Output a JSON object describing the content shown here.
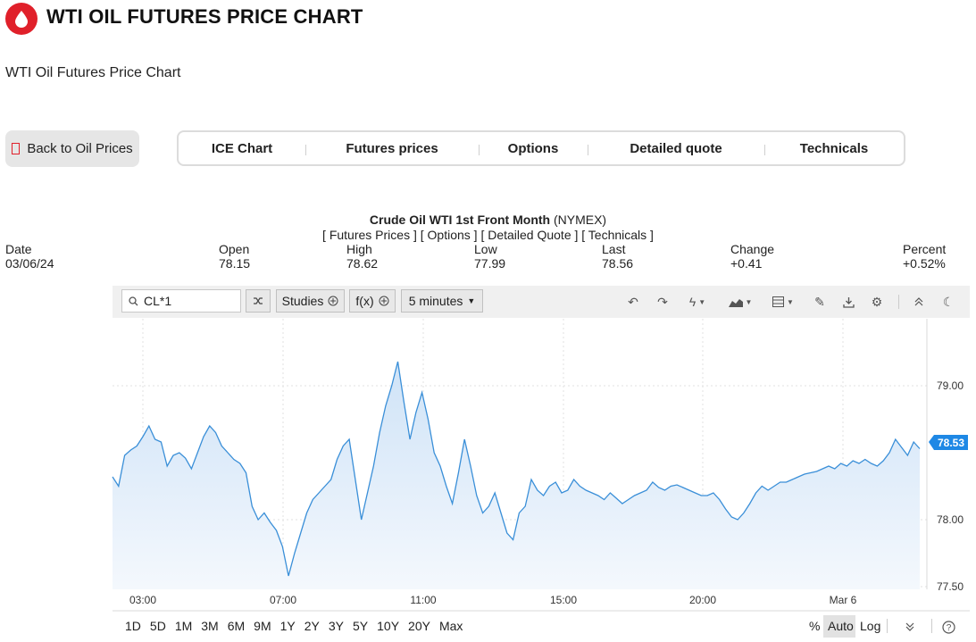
{
  "header": {
    "title": "WTI OIL FUTURES PRICE CHART",
    "subtitle": "WTI Oil Futures Price Chart",
    "logo_icon": "oil-drop-icon",
    "accent_color": "#e0202a"
  },
  "nav": {
    "back_label": "Back to Oil Prices",
    "tabs": [
      "ICE Chart",
      "Futures prices",
      "Options",
      "Detailed quote",
      "Technicals"
    ]
  },
  "quote": {
    "name": "Crude Oil WTI 1st Front Month",
    "exchange": "(NYMEX)",
    "links": "[ Futures Prices ] [ Options ] [ Detailed Quote ] [ Technicals ]",
    "stats": [
      {
        "label": "Date",
        "value": "03/06/24"
      },
      {
        "label": "Open",
        "value": "78.15"
      },
      {
        "label": "High",
        "value": "78.62"
      },
      {
        "label": "Low",
        "value": "77.99"
      },
      {
        "label": "Last",
        "value": "78.56"
      },
      {
        "label": "Change",
        "value": "+0.41"
      },
      {
        "label": "Percent",
        "value": "+0.52%"
      }
    ]
  },
  "toolbar": {
    "symbol": "CL*1",
    "studies_label": "Studies",
    "fx_label": "f(x)",
    "interval_label": "5 minutes",
    "icons": [
      "undo-icon",
      "redo-icon",
      "lightning-icon",
      "area-chart-icon",
      "layout-icon",
      "pencil-icon",
      "download-icon",
      "gear-icon",
      "collapse-icon",
      "moon-icon"
    ]
  },
  "chart_data": {
    "type": "area",
    "x_tick_labels": [
      "03:00",
      "07:00",
      "11:00",
      "15:00",
      "20:00",
      "Mar 6"
    ],
    "y_tick_labels": [
      "79.00",
      "78.00",
      "77.50"
    ],
    "ylim": [
      77.48,
      79.5
    ],
    "last_price_label": "78.53",
    "line_color": "#3a8fd8",
    "fill_color": "#dcebfa",
    "grid": true,
    "values": [
      78.32,
      78.25,
      78.48,
      78.52,
      78.55,
      78.62,
      78.7,
      78.6,
      78.58,
      78.4,
      78.48,
      78.5,
      78.46,
      78.38,
      78.5,
      78.62,
      78.7,
      78.65,
      78.55,
      78.5,
      78.45,
      78.42,
      78.35,
      78.1,
      78.0,
      78.05,
      77.98,
      77.92,
      77.8,
      77.58,
      77.75,
      77.9,
      78.05,
      78.15,
      78.2,
      78.25,
      78.3,
      78.45,
      78.55,
      78.6,
      78.3,
      78.0,
      78.2,
      78.4,
      78.65,
      78.85,
      79.0,
      79.18,
      78.88,
      78.6,
      78.8,
      78.95,
      78.75,
      78.5,
      78.4,
      78.25,
      78.12,
      78.35,
      78.6,
      78.4,
      78.18,
      78.05,
      78.1,
      78.2,
      78.05,
      77.9,
      77.85,
      78.05,
      78.1,
      78.3,
      78.22,
      78.18,
      78.25,
      78.28,
      78.2,
      78.22,
      78.3,
      78.25,
      78.22,
      78.2,
      78.18,
      78.15,
      78.2,
      78.16,
      78.12,
      78.15,
      78.18,
      78.2,
      78.22,
      78.28,
      78.24,
      78.22,
      78.25,
      78.26,
      78.24,
      78.22,
      78.2,
      78.18,
      78.18,
      78.2,
      78.15,
      78.08,
      78.02,
      78.0,
      78.05,
      78.12,
      78.2,
      78.25,
      78.22,
      78.25,
      78.28,
      78.28,
      78.3,
      78.32,
      78.34,
      78.35,
      78.36,
      78.38,
      78.4,
      78.38,
      78.42,
      78.4,
      78.44,
      78.42,
      78.45,
      78.42,
      78.4,
      78.44,
      78.5,
      78.6,
      78.54,
      78.48,
      78.58,
      78.53
    ]
  },
  "footer": {
    "ranges": [
      "1D",
      "5D",
      "1M",
      "3M",
      "6M",
      "9M",
      "1Y",
      "2Y",
      "3Y",
      "5Y",
      "10Y",
      "20Y",
      "Max"
    ],
    "scale_options": [
      "%",
      "Auto",
      "Log"
    ]
  }
}
